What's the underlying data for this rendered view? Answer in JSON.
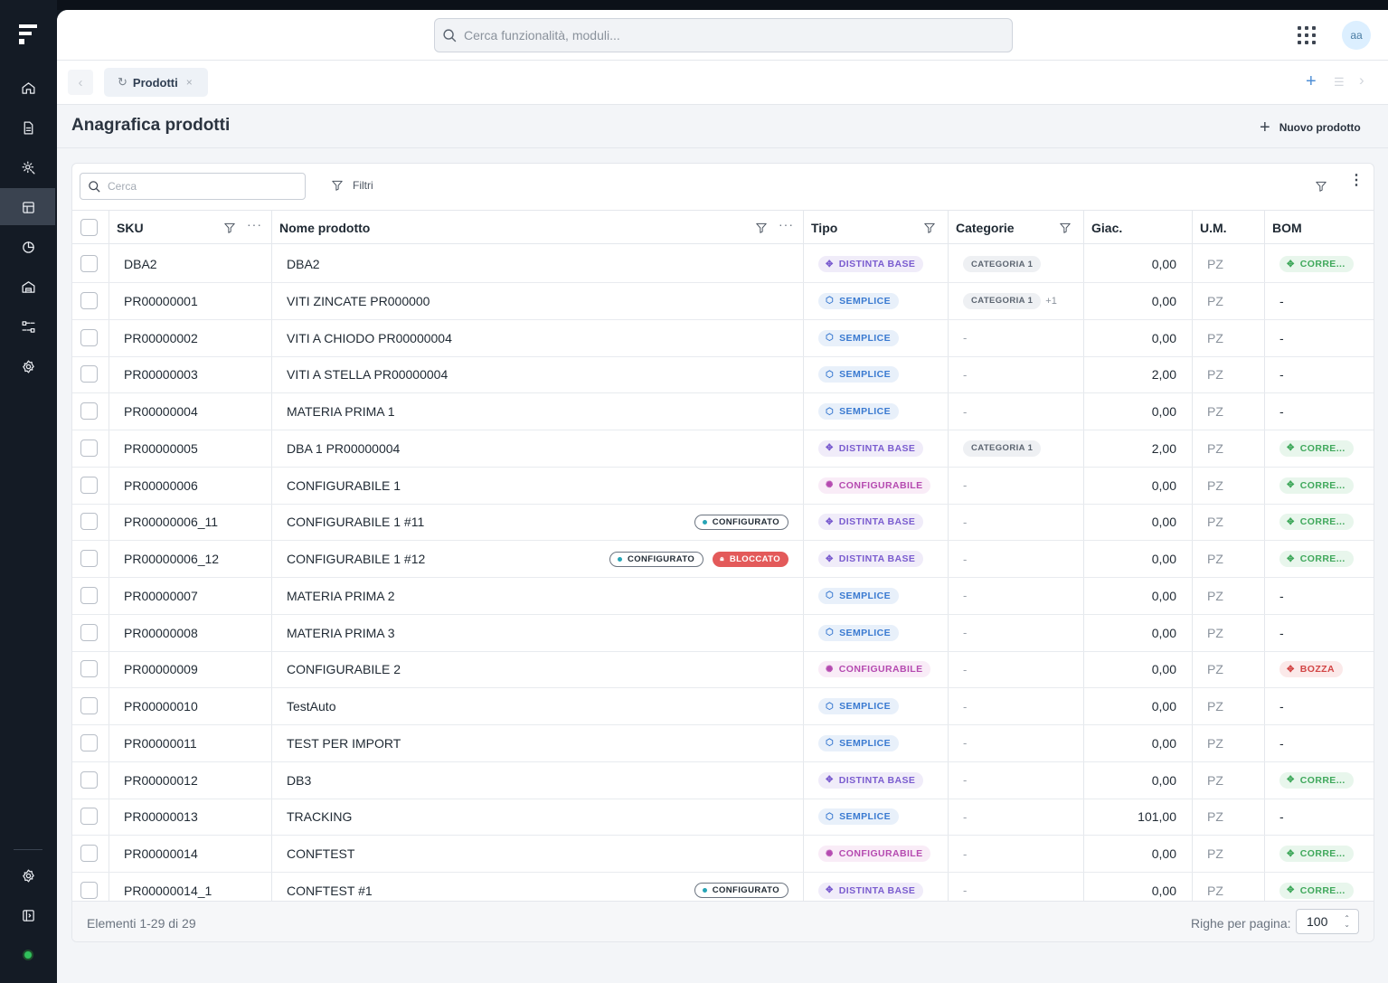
{
  "header": {
    "search_placeholder": "Cerca funzionalità, moduli...",
    "avatar": "aa"
  },
  "tabs": [
    {
      "label": "Prodotti",
      "close": "×"
    }
  ],
  "page": {
    "title": "Anagrafica prodotti",
    "new_button": "Nuovo prodotto"
  },
  "toolbar": {
    "search_placeholder": "Cerca",
    "filters_label": "Filtri"
  },
  "columns": [
    "SKU",
    "Nome prodotto",
    "Tipo",
    "Categorie",
    "Giac.",
    "U.M.",
    "BOM"
  ],
  "rows": [
    {
      "sku": "DBA2",
      "name": "DBA2",
      "tipo": "DISTINTA BASE",
      "categorie": "CATEGORIA 1",
      "extra": "",
      "giac": "0,00",
      "um": "PZ",
      "bom": "CORRE...",
      "tags": []
    },
    {
      "sku": "PR00000001",
      "name": "VITI ZINCATE PR000000",
      "tipo": "SEMPLICE",
      "categorie": "CATEGORIA 1",
      "extra": "+1",
      "giac": "0,00",
      "um": "PZ",
      "bom": "-",
      "tags": []
    },
    {
      "sku": "PR00000002",
      "name": "VITI A CHIODO PR00000004",
      "tipo": "SEMPLICE",
      "categorie": "-",
      "extra": "",
      "giac": "0,00",
      "um": "PZ",
      "bom": "-",
      "tags": []
    },
    {
      "sku": "PR00000003",
      "name": "VITI A STELLA PR00000004",
      "tipo": "SEMPLICE",
      "categorie": "-",
      "extra": "",
      "giac": "2,00",
      "um": "PZ",
      "bom": "-",
      "tags": []
    },
    {
      "sku": "PR00000004",
      "name": "MATERIA PRIMA 1",
      "tipo": "SEMPLICE",
      "categorie": "-",
      "extra": "",
      "giac": "0,00",
      "um": "PZ",
      "bom": "-",
      "tags": []
    },
    {
      "sku": "PR00000005",
      "name": "DBA 1 PR00000004",
      "tipo": "DISTINTA BASE",
      "categorie": "CATEGORIA 1",
      "extra": "",
      "giac": "2,00",
      "um": "PZ",
      "bom": "CORRE...",
      "tags": []
    },
    {
      "sku": "PR00000006",
      "name": "CONFIGURABILE 1",
      "tipo": "CONFIGURABILE",
      "categorie": "-",
      "extra": "",
      "giac": "0,00",
      "um": "PZ",
      "bom": "CORRE...",
      "tags": []
    },
    {
      "sku": "PR00000006_11",
      "name": "CONFIGURABILE 1 #11",
      "tipo": "DISTINTA BASE",
      "categorie": "-",
      "extra": "",
      "giac": "0,00",
      "um": "PZ",
      "bom": "CORRE...",
      "tags": [
        "CONFIGURATO"
      ]
    },
    {
      "sku": "PR00000006_12",
      "name": "CONFIGURABILE 1 #12",
      "tipo": "DISTINTA BASE",
      "categorie": "-",
      "extra": "",
      "giac": "0,00",
      "um": "PZ",
      "bom": "CORRE...",
      "tags": [
        "CONFIGURATO",
        "BLOCCATO"
      ]
    },
    {
      "sku": "PR00000007",
      "name": "MATERIA PRIMA 2",
      "tipo": "SEMPLICE",
      "categorie": "-",
      "extra": "",
      "giac": "0,00",
      "um": "PZ",
      "bom": "-",
      "tags": []
    },
    {
      "sku": "PR00000008",
      "name": "MATERIA PRIMA 3",
      "tipo": "SEMPLICE",
      "categorie": "-",
      "extra": "",
      "giac": "0,00",
      "um": "PZ",
      "bom": "-",
      "tags": []
    },
    {
      "sku": "PR00000009",
      "name": "CONFIGURABILE 2",
      "tipo": "CONFIGURABILE",
      "categorie": "-",
      "extra": "",
      "giac": "0,00",
      "um": "PZ",
      "bom": "BOZZA",
      "tags": []
    },
    {
      "sku": "PR00000010",
      "name": "TestAuto",
      "tipo": "SEMPLICE",
      "categorie": "-",
      "extra": "",
      "giac": "0,00",
      "um": "PZ",
      "bom": "-",
      "tags": []
    },
    {
      "sku": "PR00000011",
      "name": "TEST PER IMPORT",
      "tipo": "SEMPLICE",
      "categorie": "-",
      "extra": "",
      "giac": "0,00",
      "um": "PZ",
      "bom": "-",
      "tags": []
    },
    {
      "sku": "PR00000012",
      "name": "DB3",
      "tipo": "DISTINTA BASE",
      "categorie": "-",
      "extra": "",
      "giac": "0,00",
      "um": "PZ",
      "bom": "CORRE...",
      "tags": []
    },
    {
      "sku": "PR00000013",
      "name": "TRACKING",
      "tipo": "SEMPLICE",
      "categorie": "-",
      "extra": "",
      "giac": "101,00",
      "um": "PZ",
      "bom": "-",
      "tags": []
    },
    {
      "sku": "PR00000014",
      "name": "CONFTEST",
      "tipo": "CONFIGURABILE",
      "categorie": "-",
      "extra": "",
      "giac": "0,00",
      "um": "PZ",
      "bom": "CORRE...",
      "tags": []
    },
    {
      "sku": "PR00000014_1",
      "name": "CONFTEST #1",
      "tipo": "DISTINTA BASE",
      "categorie": "-",
      "extra": "",
      "giac": "0,00",
      "um": "PZ",
      "bom": "CORRE...",
      "tags": [
        "CONFIGURATO"
      ]
    }
  ],
  "footer": {
    "elements": "Elementi 1-29 di 29",
    "rows_per_page_label": "Righe per pagina:",
    "rows_per_page": "100"
  },
  "colors": {
    "sidebar": "#141b25",
    "accent": "#4f8fd6",
    "distinta": "#7a5ccf",
    "semplice": "#3a7ad1",
    "configurabile": "#b54ab0",
    "corrente": "#3fa85b",
    "bozza": "#d24545",
    "bloccato": "#e35a5a"
  }
}
